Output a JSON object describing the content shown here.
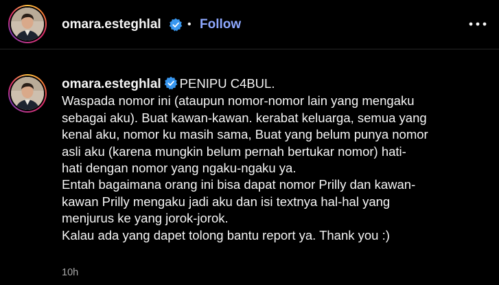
{
  "post": {
    "username": "omara.esteghlal",
    "separator": "•",
    "follow_label": "Follow",
    "more_icon": "more-horizontal-icon"
  },
  "caption": {
    "username": "omara.esteghlal",
    "title": "PENIPU C4BUL.",
    "lines": [
      "Waspada nomor ini (ataupun nomor-nomor lain yang mengaku",
      "sebagai aku). Buat kawan-kawan. kerabat keluarga, semua yang",
      "kenal aku, nomor ku masih sama, Buat yang belum punya nomor",
      "asli aku (karena mungkin belum pernah bertukar nomor) hati-",
      "hati dengan nomor yang ngaku-ngaku ya.",
      "Entah bagaimana orang ini bisa dapat nomor Prilly dan kawan-",
      "kawan Prilly mengaku jadi aku dan isi textnya hal-hal yang",
      "menjurus ke yang jorok-jorok.",
      "Kalau ada yang dapet tolong bantu report ya. Thank you :)"
    ],
    "timestamp": "10h"
  },
  "colors": {
    "background": "#000000",
    "text": "#f5f5f5",
    "follow": "#8ea8ff",
    "verified": "#3897f0",
    "muted": "#a8a8a8",
    "divider": "#262626"
  }
}
